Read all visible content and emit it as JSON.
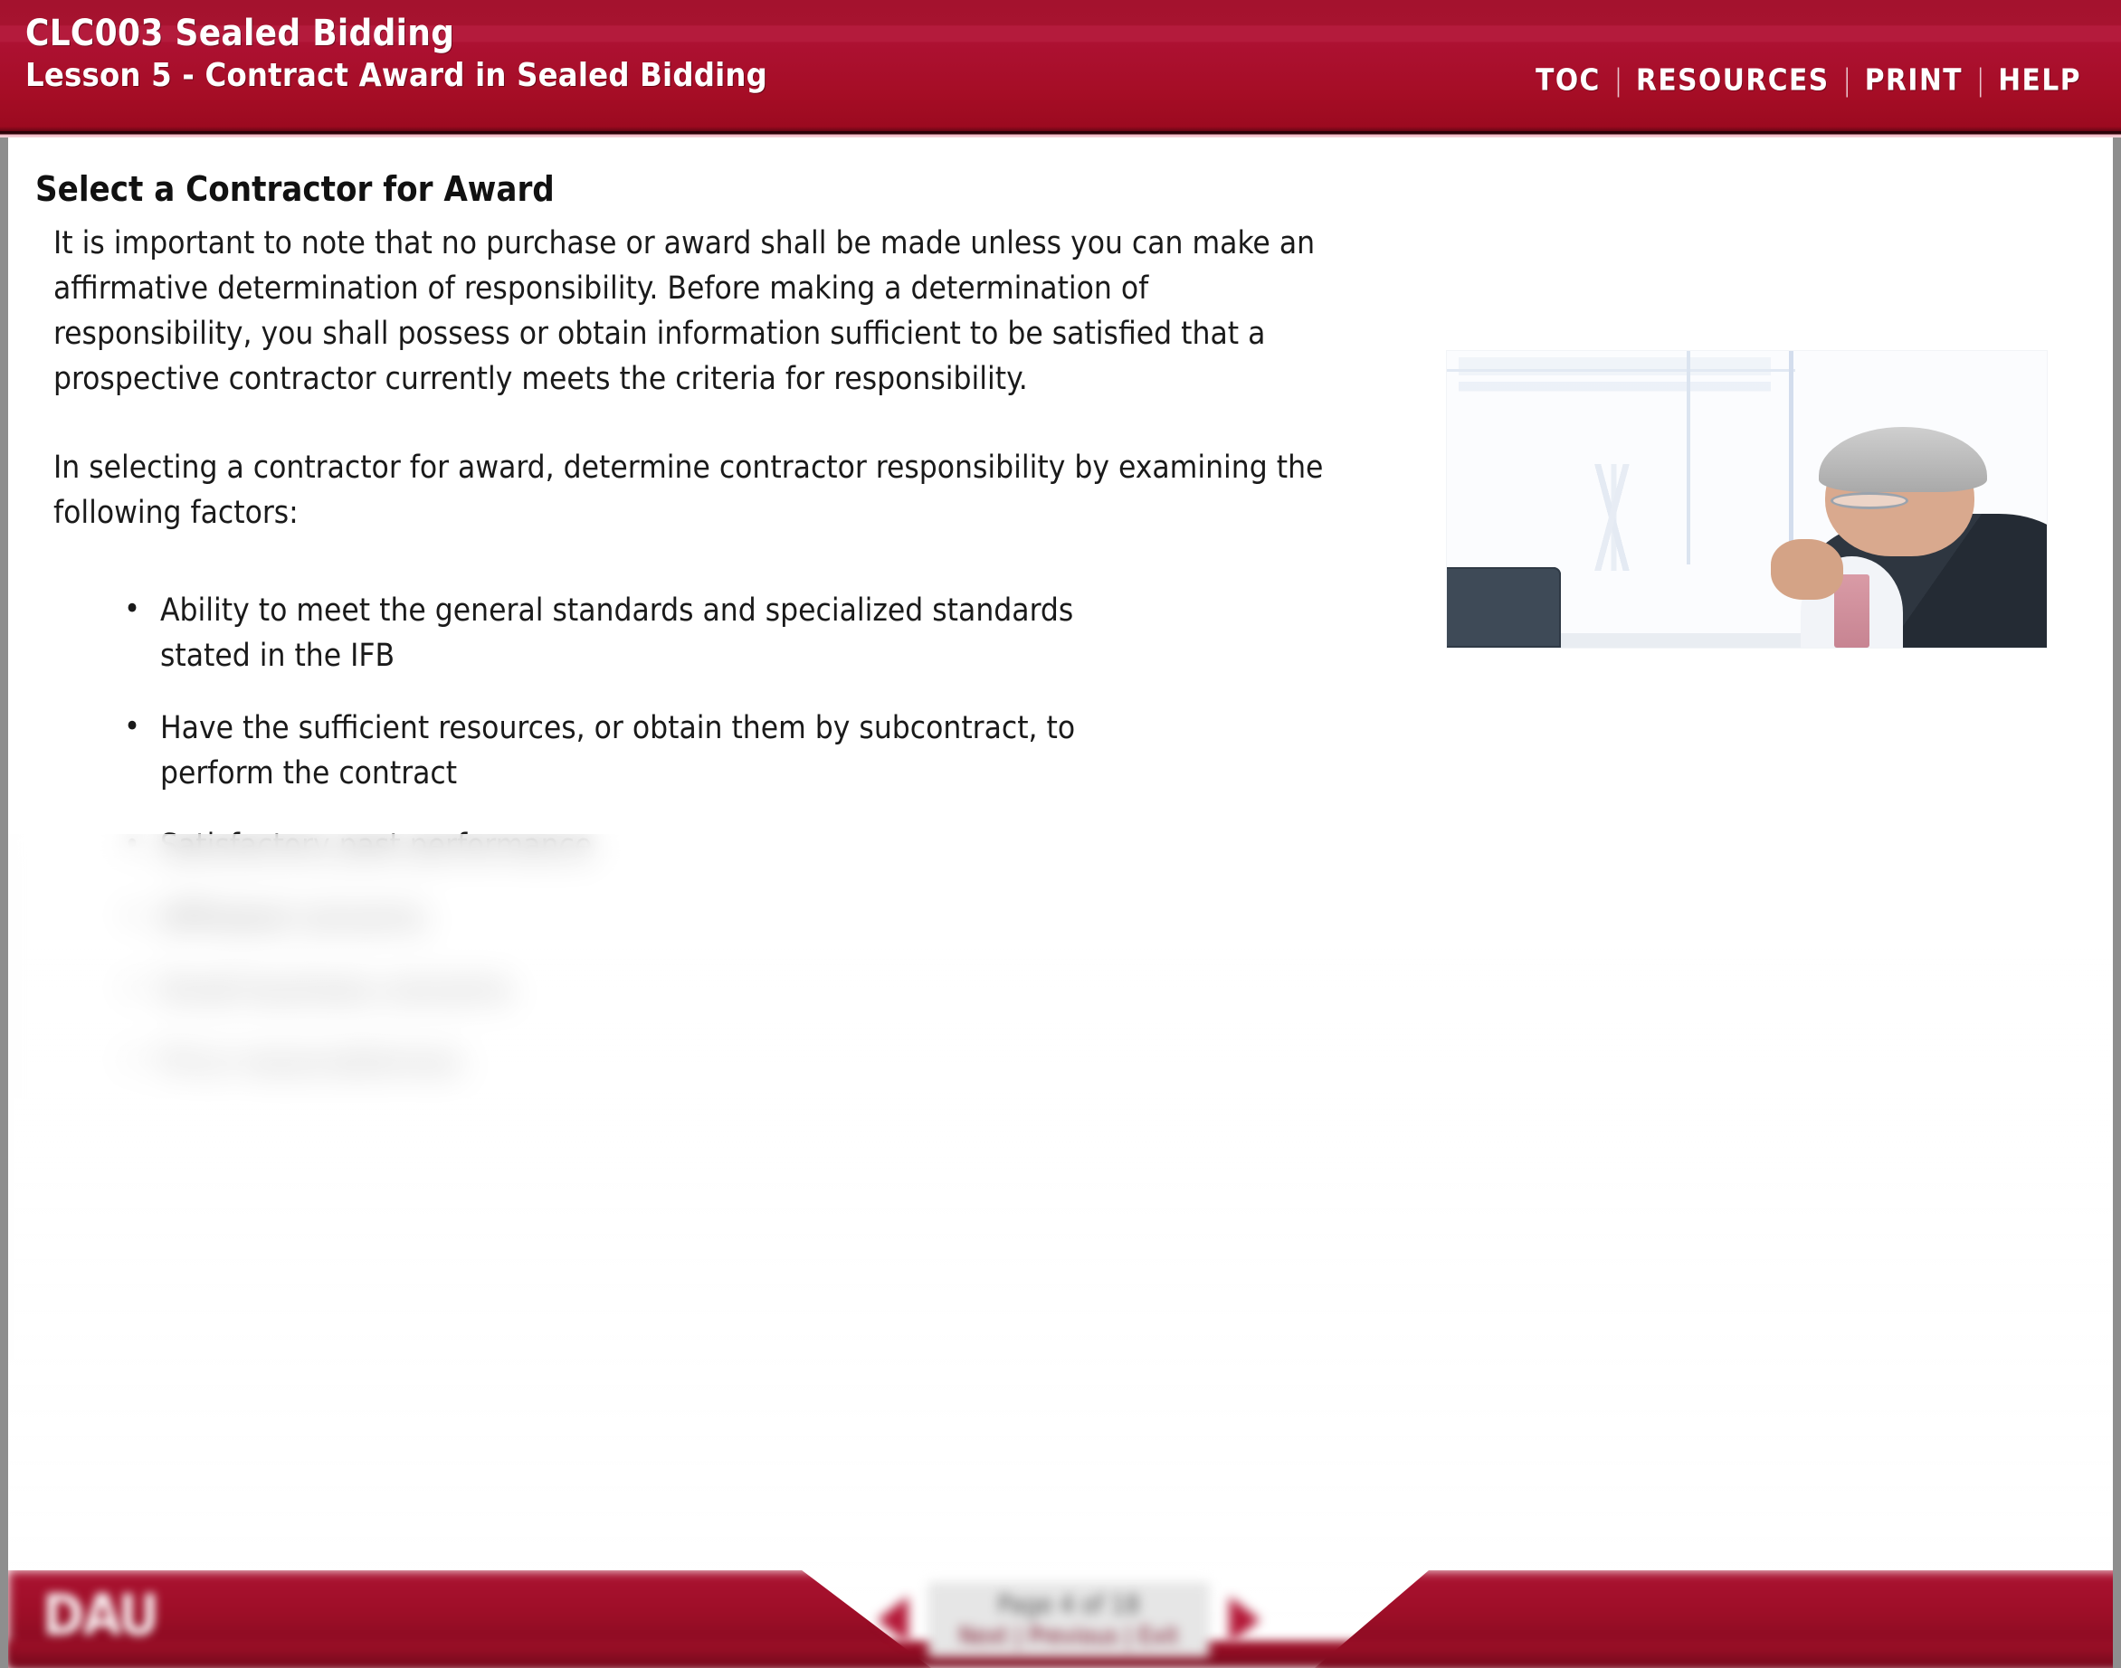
{
  "header": {
    "course_title": "CLC003 Sealed Bidding",
    "lesson_title": "Lesson 5 - Contract Award in Sealed Bidding",
    "accent_color": "#a80f26",
    "nav": [
      {
        "label": "TOC",
        "name": "toc"
      },
      {
        "label": "RESOURCES",
        "name": "resources"
      },
      {
        "label": "PRINT",
        "name": "print"
      },
      {
        "label": "HELP",
        "name": "help"
      }
    ],
    "separator": "|"
  },
  "content": {
    "page_title": "Select a Contractor for Award",
    "paragraph_1": "It is important to note that no purchase or award shall be made unless you can make an affirmative determination of responsibility. Before making a determination of responsibility, you shall possess or obtain information sufficient to be satisfied that a prospective contractor currently meets the criteria for responsibility.",
    "paragraph_2": "In selecting a contractor for award, determine contractor responsibility by examining the following factors:",
    "factors": [
      "Ability to meet the general standards and specialized standards stated in the IFB",
      "Have the sufficient resources, or obtain them by subcontract, to perform the contract",
      "Satisfactory past performance",
      "Affiliated concerns",
      "Small business concerns",
      "Price reasonableness"
    ]
  },
  "photo": {
    "alt": "Businessman in a suit with glasses seated at a desk with a monitor in a bright office"
  },
  "footer": {
    "logo_text": "DAU",
    "page_indicator": "Page 4 of 18",
    "nav_label": "Next | Previous | Exit",
    "prev_icon": "triangle-left-icon",
    "next_icon": "triangle-right-icon"
  }
}
